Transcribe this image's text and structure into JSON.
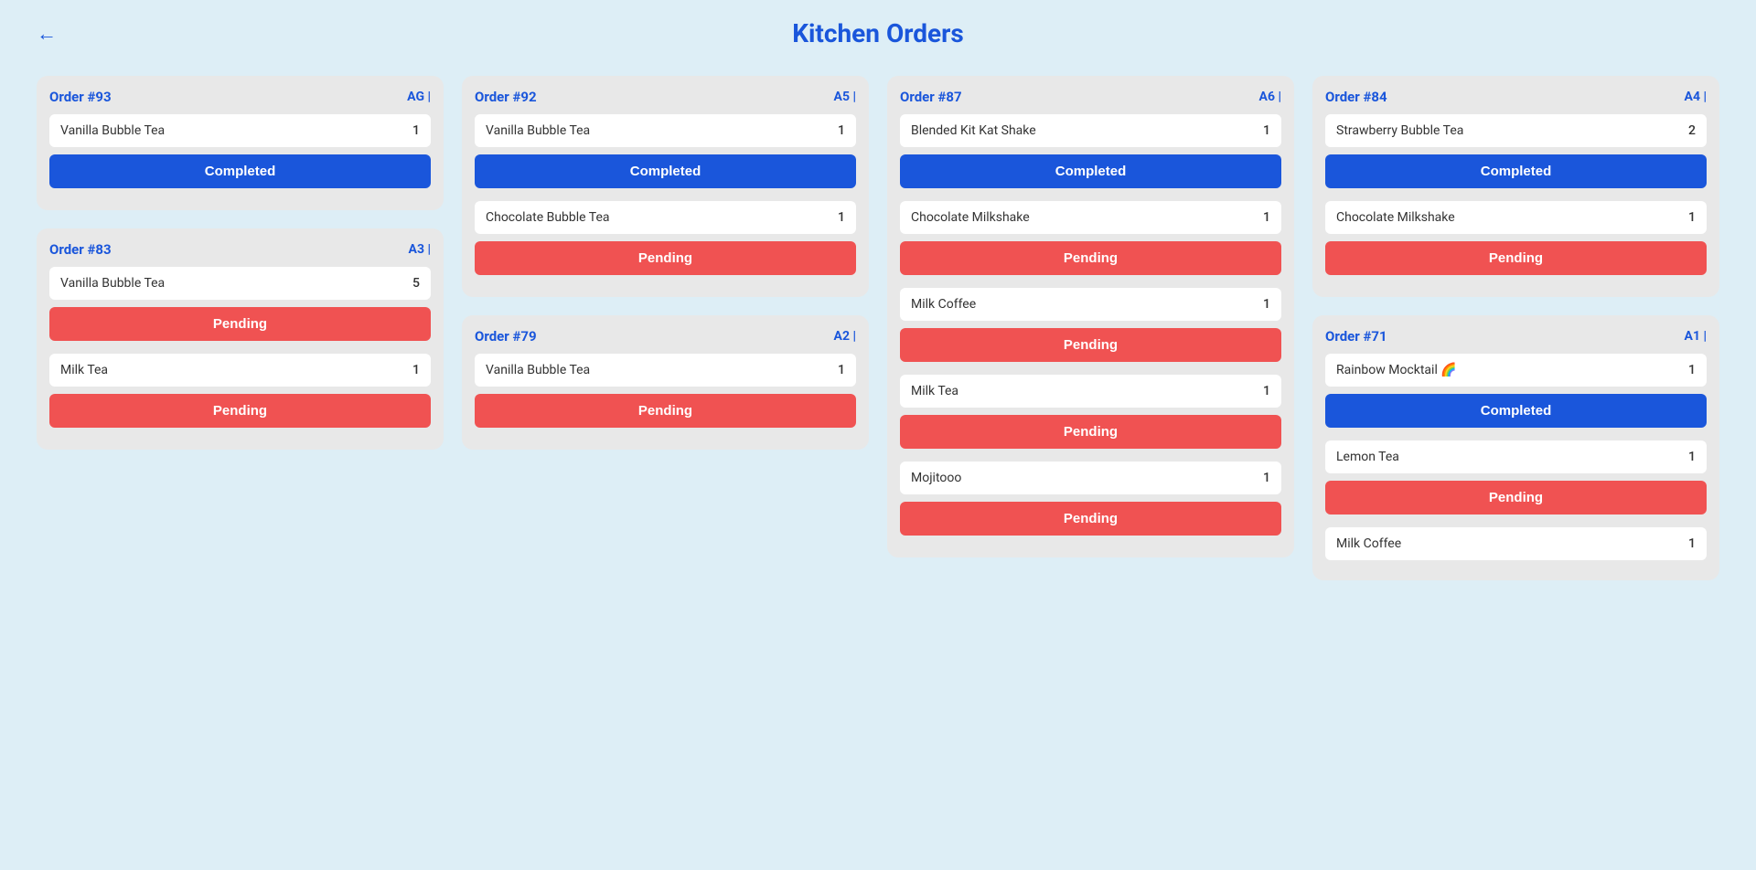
{
  "page": {
    "title": "Kitchen Orders",
    "back_label": "←"
  },
  "columns": [
    {
      "cards": [
        {
          "order_number": "Order #93",
          "table": "AG |",
          "items": [
            {
              "name": "Vanilla Bubble Tea",
              "qty": 1,
              "status": "Completed",
              "status_type": "completed"
            }
          ]
        },
        {
          "order_number": "Order #83",
          "table": "A3 |",
          "items": [
            {
              "name": "Vanilla Bubble Tea",
              "qty": 5,
              "status": "Pending",
              "status_type": "pending"
            },
            {
              "name": "Milk Tea",
              "qty": 1,
              "status": "Pending",
              "status_type": "pending"
            }
          ]
        }
      ]
    },
    {
      "cards": [
        {
          "order_number": "Order #92",
          "table": "A5 |",
          "items": [
            {
              "name": "Vanilla Bubble Tea",
              "qty": 1,
              "status": "Completed",
              "status_type": "completed"
            },
            {
              "name": "Chocolate Bubble Tea",
              "qty": 1,
              "status": "Pending",
              "status_type": "pending"
            }
          ]
        },
        {
          "order_number": "Order #79",
          "table": "A2 |",
          "items": [
            {
              "name": "Vanilla Bubble Tea",
              "qty": 1,
              "status": "Pending",
              "status_type": "pending"
            }
          ]
        }
      ]
    },
    {
      "cards": [
        {
          "order_number": "Order #87",
          "table": "A6 |",
          "items": [
            {
              "name": "Blended Kit Kat Shake",
              "qty": 1,
              "status": "Completed",
              "status_type": "completed"
            },
            {
              "name": "Chocolate Milkshake",
              "qty": 1,
              "status": "Pending",
              "status_type": "pending"
            },
            {
              "name": "Milk Coffee",
              "qty": 1,
              "status": "Pending",
              "status_type": "pending"
            },
            {
              "name": "Milk Tea",
              "qty": 1,
              "status": "Pending",
              "status_type": "pending"
            },
            {
              "name": "Mojitooo",
              "qty": 1,
              "status": "Pending",
              "status_type": "pending"
            }
          ]
        }
      ]
    },
    {
      "cards": [
        {
          "order_number": "Order #84",
          "table": "A4 |",
          "items": [
            {
              "name": "Strawberry Bubble Tea",
              "qty": 2,
              "status": "Completed",
              "status_type": "completed"
            },
            {
              "name": "Chocolate Milkshake",
              "qty": 1,
              "status": "Pending",
              "status_type": "pending"
            }
          ]
        },
        {
          "order_number": "Order #71",
          "table": "A1 |",
          "items": [
            {
              "name": "Rainbow Mocktail 🌈",
              "qty": 1,
              "status": "Completed",
              "status_type": "completed"
            },
            {
              "name": "Lemon Tea",
              "qty": 1,
              "status": "Pending",
              "status_type": "pending"
            },
            {
              "name": "Milk Coffee",
              "qty": 1,
              "status": "",
              "status_type": "none"
            }
          ]
        }
      ]
    }
  ]
}
